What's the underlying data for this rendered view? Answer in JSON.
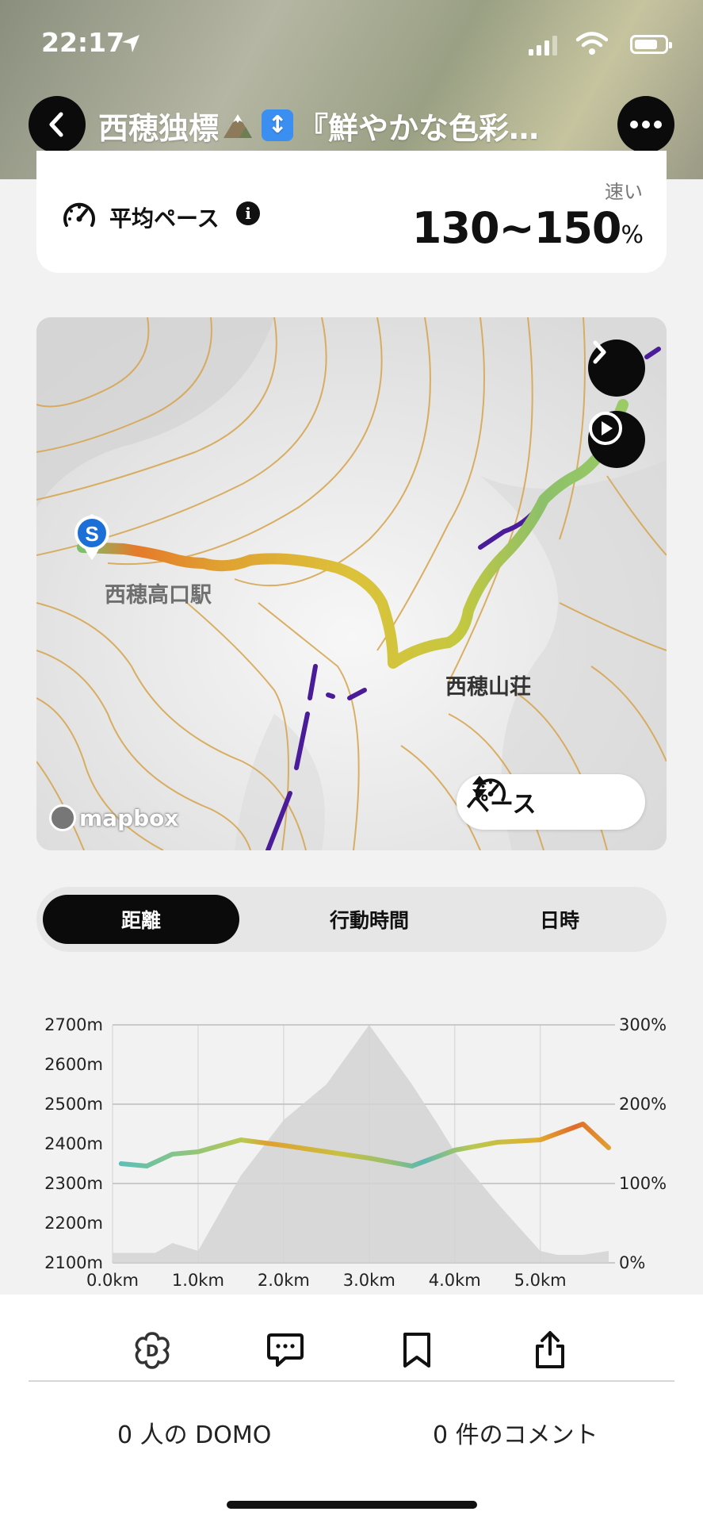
{
  "status_bar": {
    "time": "22:17"
  },
  "header": {
    "title_part1": "西穂独標",
    "title_part2": "『鮮やかな色彩…",
    "mountain_icon": "mountain-emoji-icon",
    "updown_icon": "up-down-arrow-icon",
    "updown_glyph": "↕"
  },
  "pace_card": {
    "label": "平均ペース",
    "fast_label": "速い",
    "value": "130~150",
    "unit": "%"
  },
  "map": {
    "labels": {
      "station": "西穂高口駅",
      "hut": "西穂山荘"
    },
    "start_marker": "S",
    "mapbox_text": "mapbox",
    "chip_label": "ペース"
  },
  "segment": {
    "tabs": [
      {
        "label": "距離"
      },
      {
        "label": "行動時間"
      },
      {
        "label": "日時"
      }
    ],
    "active_index": 0
  },
  "chart_data": {
    "type": "area",
    "x_ticks": [
      "0.0km",
      "1.0km",
      "2.0km",
      "3.0km",
      "4.0km",
      "5.0km"
    ],
    "y_left_ticks": [
      "2700m",
      "2600m",
      "2500m",
      "2400m",
      "2300m",
      "2200m",
      "2100m"
    ],
    "y_right_ticks": [
      "300%",
      "200%",
      "100%",
      "0%"
    ],
    "y_left_range": [
      2100,
      2700
    ],
    "y_right_range": [
      0,
      300
    ],
    "x_range": [
      0,
      5.8
    ],
    "series": [
      {
        "x": [
          0.0,
          0.5,
          0.7,
          1.0,
          1.5,
          2.0,
          2.5,
          2.8,
          3.0,
          3.2,
          3.5,
          3.8,
          4.0,
          4.5,
          5.0,
          5.2,
          5.5,
          5.8
        ],
        "values": [
          2125,
          2125,
          2150,
          2130,
          2320,
          2460,
          2550,
          2640,
          2700,
          2640,
          2550,
          2450,
          2380,
          2250,
          2130,
          2120,
          2120,
          2130
        ]
      },
      {
        "x": [
          0.1,
          0.4,
          0.7,
          1.0,
          1.5,
          2.0,
          2.5,
          3.0,
          3.5,
          4.0,
          4.5,
          5.0,
          5.5,
          5.8
        ],
        "values": [
          125,
          122,
          137,
          140,
          155,
          148,
          140,
          132,
          122,
          142,
          152,
          155,
          175,
          145
        ]
      }
    ]
  },
  "actions": {
    "domo_icon": "domo-flower-icon",
    "comment_icon": "comment-icon",
    "bookmark_icon": "bookmark-icon",
    "share_icon": "share-icon"
  },
  "counts": {
    "domo": "0 人の DOMO",
    "comments": "0 件のコメント"
  }
}
